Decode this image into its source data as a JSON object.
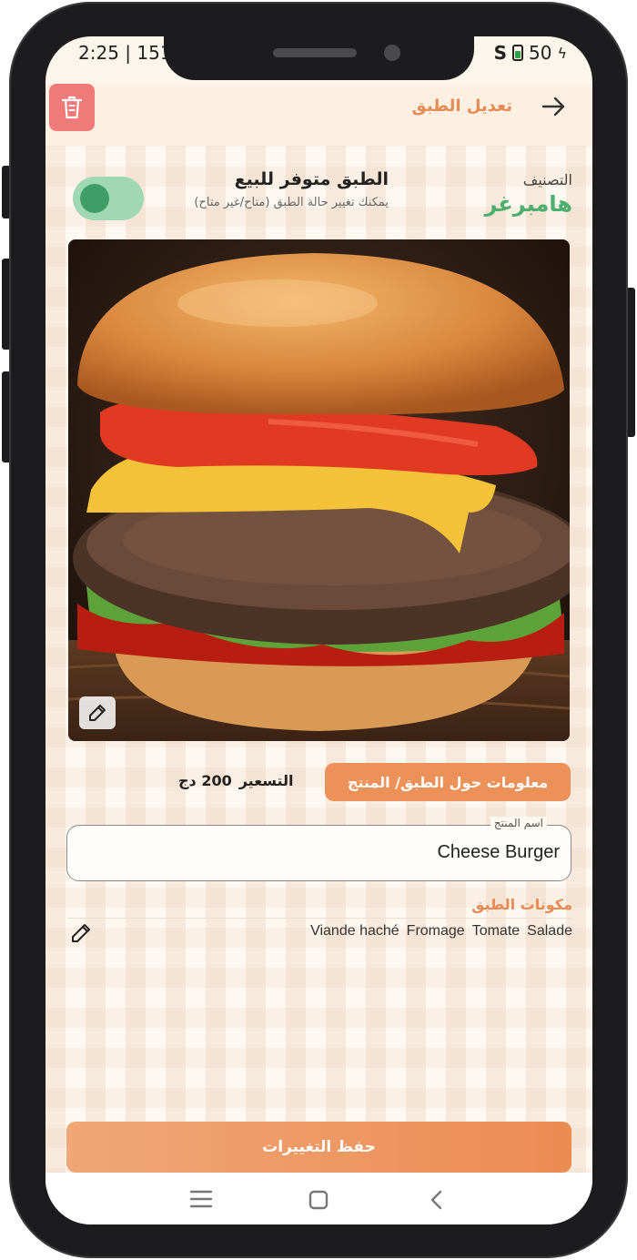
{
  "status_bar": {
    "time": "2:25 | 151",
    "battery": "50"
  },
  "header": {
    "title": "تعديل الطبق"
  },
  "category": {
    "label": "التصنيف",
    "value": "هامبرغر"
  },
  "availability": {
    "title": "الطبق متوفر للبيع",
    "subtitle": "يمكنك تغيير حالة الطبق (متاح/غير متاح)",
    "enabled": true
  },
  "product": {
    "info_button": "معلومات حول الطبق/ المنتج",
    "price_label": "التسعير",
    "price_value": "200 دج",
    "name_label": "اسم المنتج",
    "name_value": "Cheese Burger"
  },
  "ingredients": {
    "title": "مكونات الطبق",
    "items": [
      "Salade",
      "Tomate",
      "Fromage",
      "Viande haché"
    ]
  },
  "actions": {
    "save_label": "حفظ التغييرات"
  },
  "colors": {
    "accent": "#eb8c52",
    "success": "#4caf6e",
    "danger": "#f07a7a"
  },
  "icons": {
    "trash": "trash-icon",
    "back": "arrow-right-icon",
    "edit": "edit-icon"
  }
}
